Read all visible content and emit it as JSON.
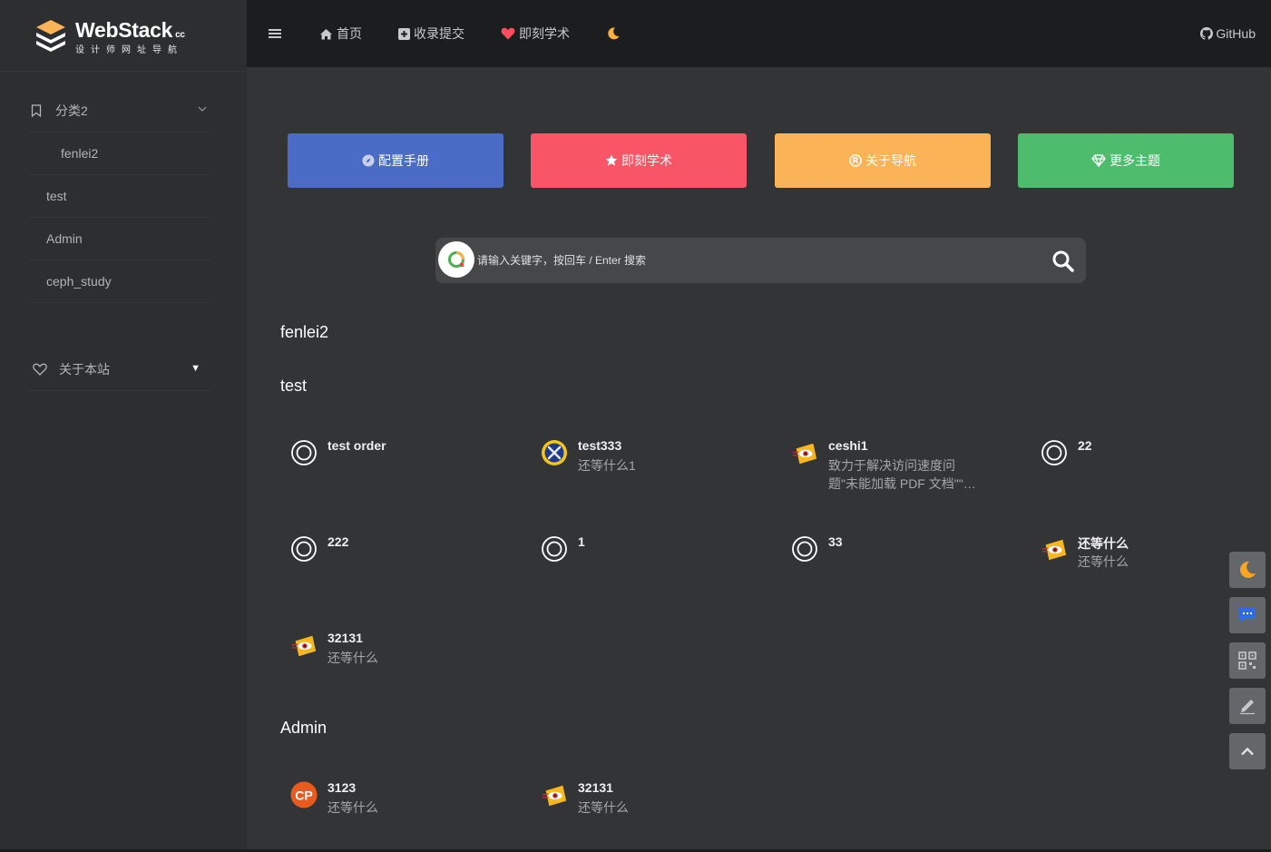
{
  "brand": {
    "title": "WebStack",
    "suffix": "cc",
    "subtitle": "设计师网址导航",
    "icon": "layers-icon"
  },
  "sidebar": {
    "items": [
      {
        "label": "分类2",
        "icon": "bookmark-icon",
        "expanded": true
      },
      {
        "label": "fenlei2",
        "sub": true
      },
      {
        "label": "test"
      },
      {
        "label": "Admin"
      },
      {
        "label": "ceph_study"
      }
    ],
    "about": {
      "label": "关于本站",
      "icon": "heart-icon"
    }
  },
  "topnav": {
    "items": [
      {
        "label": "首页",
        "icon": "home-icon"
      },
      {
        "label": "收录提交",
        "icon": "plus-square-icon"
      },
      {
        "label": "即刻学术",
        "icon": "heart-icon",
        "color": "#ff4d5e"
      }
    ],
    "theme_icon": "moon-icon",
    "github": "GitHub"
  },
  "quick_buttons": [
    {
      "label": "配置手册",
      "icon": "compass-icon",
      "color": "#4a6bc6"
    },
    {
      "label": "即刻学术",
      "icon": "star-icon",
      "color": "#f85667"
    },
    {
      "label": "关于导航",
      "icon": "registered-icon",
      "color": "#fbb357"
    },
    {
      "label": "更多主题",
      "icon": "diamond-icon",
      "color": "#4dbd6d"
    }
  ],
  "search": {
    "placeholder": "请输入关键字，按回车 / Enter 搜索",
    "value": ""
  },
  "sections": [
    {
      "title": "fenlei2",
      "cards": []
    },
    {
      "title": "test",
      "cards": [
        {
          "title": "test order",
          "desc": "",
          "icon": "target-icon"
        },
        {
          "title": "test333",
          "desc": "还等什么1",
          "icon": "tools-icon"
        },
        {
          "title": "ceshi1",
          "desc": "致力于解决访问速度问题\"未能加载 PDF 文档\"\"…",
          "icon": "eye-icon"
        },
        {
          "title": "22",
          "desc": "",
          "icon": "target-icon"
        },
        {
          "title": "222",
          "desc": "",
          "icon": "target-icon"
        },
        {
          "title": "1",
          "desc": "",
          "icon": "target-icon"
        },
        {
          "title": "33",
          "desc": "",
          "icon": "target-icon"
        },
        {
          "title": "还等什么",
          "desc": "还等什么",
          "icon": "eye-icon"
        },
        {
          "title": "32131",
          "desc": "还等什么",
          "icon": "eye-icon"
        }
      ]
    },
    {
      "title": "Admin",
      "cards": [
        {
          "title": "3123",
          "desc": "还等什么",
          "icon": "cp-logo-icon"
        },
        {
          "title": "32131",
          "desc": "还等什么",
          "icon": "eye-icon"
        }
      ]
    }
  ],
  "float_buttons": [
    {
      "name": "theme-toggle",
      "icon": "moon-icon"
    },
    {
      "name": "feedback",
      "icon": "chat-icon"
    },
    {
      "name": "qrcode",
      "icon": "qrcode-icon"
    },
    {
      "name": "edit",
      "icon": "pencil-icon"
    },
    {
      "name": "back-to-top",
      "icon": "chevron-up-icon"
    }
  ]
}
